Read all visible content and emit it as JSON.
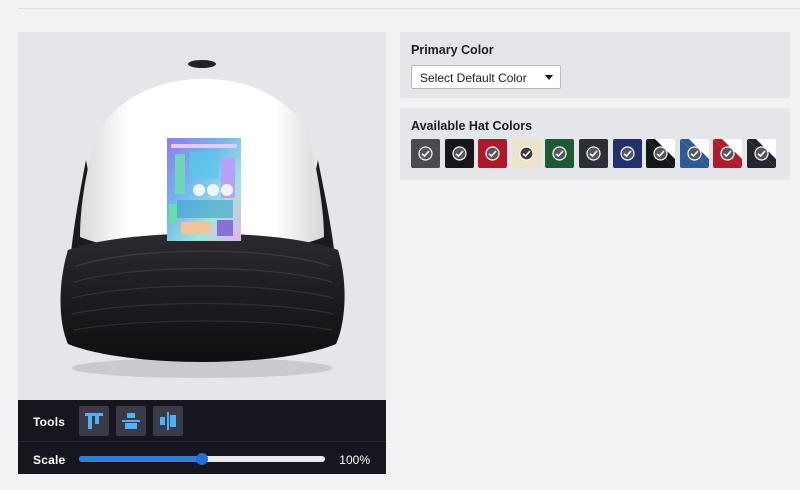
{
  "tools": {
    "label": "Tools",
    "buttons": [
      {
        "name": "align-top-tool-icon"
      },
      {
        "name": "align-vertical-center-tool-icon"
      },
      {
        "name": "align-horizontal-center-tool-icon"
      }
    ]
  },
  "scale": {
    "label": "Scale",
    "value_text": "100%",
    "fraction": 0.5
  },
  "primary_color": {
    "title": "Primary Color",
    "select_value": "Select Default Color"
  },
  "hat_colors": {
    "title": "Available Hat Colors",
    "swatches": [
      {
        "name": "swatch-charcoal",
        "colors": [
          "#4a4b50"
        ]
      },
      {
        "name": "swatch-black",
        "colors": [
          "#17171b"
        ]
      },
      {
        "name": "swatch-red",
        "colors": [
          "#b0182a"
        ]
      },
      {
        "name": "swatch-tan",
        "colors": [
          "#ece3c9"
        ]
      },
      {
        "name": "swatch-forest-green",
        "colors": [
          "#1e5a31"
        ]
      },
      {
        "name": "swatch-dark-gray",
        "colors": [
          "#2d2e36"
        ]
      },
      {
        "name": "swatch-navy",
        "colors": [
          "#22306e"
        ]
      },
      {
        "name": "swatch-black-white",
        "colors": [
          "#ffffff",
          "#15151a"
        ]
      },
      {
        "name": "swatch-navy-white",
        "colors": [
          "#ffffff",
          "#2f5a96"
        ]
      },
      {
        "name": "swatch-red-white",
        "colors": [
          "#ffffff",
          "#b01c2e"
        ]
      },
      {
        "name": "swatch-charcoal-white",
        "colors": [
          "#ffffff",
          "#25262d"
        ]
      }
    ]
  },
  "hat": {
    "front_color": "#ffffff",
    "back_color": "#1b1b1f"
  }
}
